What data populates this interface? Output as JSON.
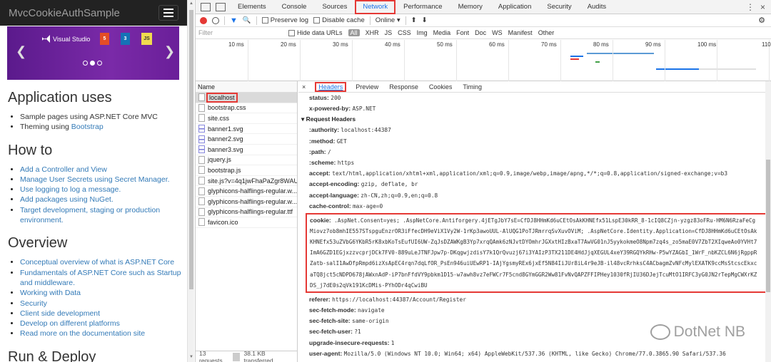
{
  "site": {
    "brand": "MvcCookieAuthSample",
    "carousel": {
      "logo_text": "Visual Studio",
      "badges": [
        "5",
        "3",
        "JS"
      ]
    },
    "sections": [
      {
        "title": "Application uses",
        "items": [
          {
            "pre": "Sample pages using ASP.NET Core MVC",
            "link": ""
          },
          {
            "pre": "Theming using ",
            "link": "Bootstrap"
          }
        ]
      },
      {
        "title": "How to",
        "items": [
          {
            "pre": "",
            "link": "Add a Controller and View"
          },
          {
            "pre": "",
            "link": "Manage User Secrets using Secret Manager."
          },
          {
            "pre": "",
            "link": "Use logging to log a message."
          },
          {
            "pre": "",
            "link": "Add packages using NuGet."
          },
          {
            "pre": "",
            "link": "Target development, staging or production environment."
          }
        ]
      },
      {
        "title": "Overview",
        "items": [
          {
            "pre": "",
            "link": "Conceptual overview of what is ASP.NET Core"
          },
          {
            "pre": "",
            "link": "Fundamentals of ASP.NET Core such as Startup and middleware."
          },
          {
            "pre": "",
            "link": "Working with Data"
          },
          {
            "pre": "",
            "link": "Security"
          },
          {
            "pre": "",
            "link": "Client side development"
          },
          {
            "pre": "",
            "link": "Develop on different platforms"
          },
          {
            "pre": "",
            "link": "Read more on the documentation site"
          }
        ]
      },
      {
        "title": "Run & Deploy",
        "items": []
      }
    ]
  },
  "devtools": {
    "tabs": [
      "Elements",
      "Console",
      "Sources",
      "Network",
      "Performance",
      "Memory",
      "Application",
      "Security",
      "Audits"
    ],
    "active_tab": "Network",
    "toolbar": {
      "preserve_log": "Preserve log",
      "disable_cache": "Disable cache",
      "throttle": "Online"
    },
    "filter": {
      "placeholder": "Filter",
      "hide_data_urls": "Hide data URLs",
      "types": [
        "All",
        "XHR",
        "JS",
        "CSS",
        "Img",
        "Media",
        "Font",
        "Doc",
        "WS",
        "Manifest",
        "Other"
      ]
    },
    "timeline_ticks": [
      "10 ms",
      "20 ms",
      "30 ms",
      "40 ms",
      "50 ms",
      "60 ms",
      "70 ms",
      "80 ms",
      "90 ms",
      "100 ms",
      "110"
    ],
    "request_list": {
      "header": "Name",
      "items": [
        {
          "name": "localhost",
          "type": "doc"
        },
        {
          "name": "bootstrap.css",
          "type": "doc"
        },
        {
          "name": "site.css",
          "type": "doc"
        },
        {
          "name": "banner1.svg",
          "type": "svg"
        },
        {
          "name": "banner2.svg",
          "type": "svg"
        },
        {
          "name": "banner3.svg",
          "type": "svg"
        },
        {
          "name": "jquery.js",
          "type": "doc"
        },
        {
          "name": "bootstrap.js",
          "type": "doc"
        },
        {
          "name": "site.js?v=4q1jwFhaPaZgr8WAU...",
          "type": "doc"
        },
        {
          "name": "glyphicons-halflings-regular.w...",
          "type": "doc"
        },
        {
          "name": "glyphicons-halflings-regular.w...",
          "type": "doc"
        },
        {
          "name": "glyphicons-halflings-regular.ttf",
          "type": "doc"
        },
        {
          "name": "favicon.ico",
          "type": "doc"
        }
      ],
      "footer": {
        "requests": "13 requests",
        "transferred": "38.1 KB transferred"
      }
    },
    "detail_tabs": [
      "Headers",
      "Preview",
      "Response",
      "Cookies",
      "Timing"
    ],
    "response_headers": [
      {
        "k": "status:",
        "v": "200"
      },
      {
        "k": "x-powered-by:",
        "v": "ASP.NET"
      }
    ],
    "request_headers_title": "Request Headers",
    "request_headers_before": [
      {
        "k": ":authority:",
        "v": "localhost:44387"
      },
      {
        "k": ":method:",
        "v": "GET"
      },
      {
        "k": ":path:",
        "v": "/"
      },
      {
        "k": ":scheme:",
        "v": "https"
      },
      {
        "k": "accept:",
        "v": "text/html,application/xhtml+xml,application/xml;q=0.9,image/webp,image/apng,*/*;q=0.8,application/signed-exchange;v=b3"
      },
      {
        "k": "accept-encoding:",
        "v": "gzip, deflate, br"
      },
      {
        "k": "accept-language:",
        "v": "zh-CN,zh;q=0.9,en;q=0.8"
      },
      {
        "k": "cache-control:",
        "v": "max-age=0"
      }
    ],
    "cookie": {
      "k": "cookie:",
      "lines": [
        ".AspNet.Consent=yes; .AspNetCore.Antiforgery.4jETgJbY7sE=CfDJ8HHmKd6uCEtOsAkKHNEfx51LspE30kRR_8-1cIQ8CZjn-yzgz83oFRu-HM6N6RzaFeCg",
        "Miovz7ob8mhIE557STspguEnzrOR3iFfecDH9eViX1Vy2W-1rKp3awoUUL-AlUQG1PoTJRmrrqSvXuvOViM; .AspNetCore.Identity.Application=CfDJ8HHmKd6uCEtOsAk",
        "KHNEfx53uZVbG6YKbR5rK8xbKoTsEufUI6UW-ZqJsDZAWKgB3Yp7xrqQAmk6zNJvtDYOmhrJGXxtHIzBxaT7AwVG01nJ5yykokmeO8Npm7zq4s_zo5maE0V7ZbT2XIqweAo0YVHt7",
        "ImA6GZD1EGjxzzvcprjDCk7FV0-889uLeJTNFJpw7p-DKqgwjzdisY7k1QrQvuzj67i3YAIzP3TX211DE4HdJjqXEGUL4xeY39RGQYkRHw-P5wYZAGbI_1WrF_nbKZCL6N6jRgppR",
        "Zatb-salI1AwDfpRmpd6izXsApEC4rqn7dqLfOR_PsEn946uiUEwRP1-IAjYgsmyREx6jxEf5N84IiJUr8iL4r9eJB-il48vcRrhksC4ACbagmZvNFcMylEXATK9ccMsStcscEkxc",
        "aTQ8jct5cNDPD678jAWxnAdP-iP7bnFfdVY9pbkm1D15-w7awh8vz7eFWCr7F5cnd8GYmGGR2Ww81FvNvQAPZFFIPHey1030fRjIU36DJejTcuMtO1IRFC3yG0JN2rTepMgCWXrKZ",
        "DS_j7dE0s2qVk191KcDMis-PYhODr4qCwiBU"
      ]
    },
    "request_headers_after": [
      {
        "k": "referer:",
        "v": "https://localhost:44387/Account/Register"
      },
      {
        "k": "sec-fetch-mode:",
        "v": "navigate"
      },
      {
        "k": "sec-fetch-site:",
        "v": "same-origin"
      },
      {
        "k": "sec-fetch-user:",
        "v": "?1"
      },
      {
        "k": "upgrade-insecure-requests:",
        "v": "1"
      },
      {
        "k": "user-agent:",
        "v": "Mozilla/5.0 (Windows NT 10.0; Win64; x64) AppleWebKit/537.36 (KHTML, like Gecko) Chrome/77.0.3865.90 Safari/537.36"
      }
    ],
    "watermark": "DotNet NB"
  }
}
